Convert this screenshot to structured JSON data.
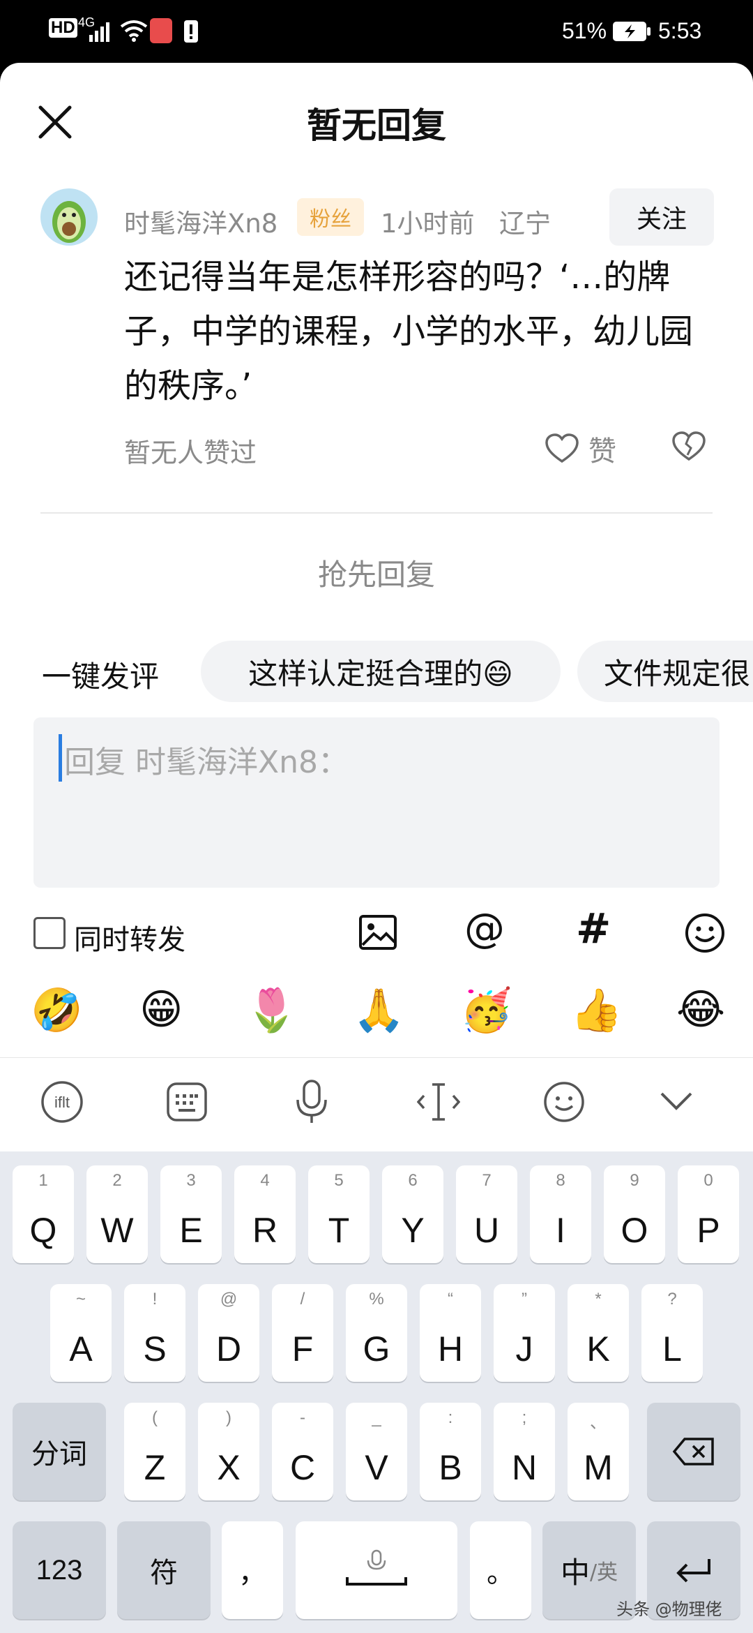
{
  "status_bar": {
    "hd": "HD",
    "network": "4G",
    "battery_percent": "51%",
    "time": "5:53"
  },
  "sheet": {
    "title": "暂无回复"
  },
  "comment": {
    "username": "时髦海洋Xn8",
    "badge": "粉丝",
    "time_ago": "1小时前",
    "location": "辽宁",
    "follow_label": "关注",
    "text": "还记得当年是怎样形容的吗？‘…的牌子，中学的课程，小学的水平，幼儿园的秩序。’",
    "likes_text": "暂无人赞过",
    "like_label": "赞"
  },
  "reply_first": "抢先回复",
  "quick_reply": {
    "label": "一键发评",
    "chips": [
      "这样认定挺合理的😄",
      "文件规定很"
    ]
  },
  "reply_input": {
    "placeholder": "回复 时髦海洋Xn8："
  },
  "repost": {
    "label": "同时转发",
    "checked": false
  },
  "tools": {
    "image_icon": "image-icon",
    "at_symbol": "@",
    "hash_symbol": "#",
    "emoji_icon": "smiley-icon"
  },
  "emoji_row": [
    "🤣",
    "😁",
    "🌷",
    "🙏",
    "🥳",
    "👍",
    "😂"
  ],
  "ime_toolbar": {
    "icons": [
      "ime-logo-icon",
      "keyboard-icon",
      "microphone-icon",
      "cursor-icon",
      "smiley-icon",
      "chevron-down-icon"
    ]
  },
  "keyboard": {
    "row1": [
      {
        "main": "Q",
        "sub": "1"
      },
      {
        "main": "W",
        "sub": "2"
      },
      {
        "main": "E",
        "sub": "3"
      },
      {
        "main": "R",
        "sub": "4"
      },
      {
        "main": "T",
        "sub": "5"
      },
      {
        "main": "Y",
        "sub": "6"
      },
      {
        "main": "U",
        "sub": "7"
      },
      {
        "main": "I",
        "sub": "8"
      },
      {
        "main": "O",
        "sub": "9"
      },
      {
        "main": "P",
        "sub": "0"
      }
    ],
    "row2": [
      {
        "main": "A",
        "sub": "~"
      },
      {
        "main": "S",
        "sub": "!"
      },
      {
        "main": "D",
        "sub": "@"
      },
      {
        "main": "F",
        "sub": "/"
      },
      {
        "main": "G",
        "sub": "%"
      },
      {
        "main": "H",
        "sub": "“"
      },
      {
        "main": "J",
        "sub": "”"
      },
      {
        "main": "K",
        "sub": "*"
      },
      {
        "main": "L",
        "sub": "?"
      }
    ],
    "row3": [
      {
        "main": "Z",
        "sub": "("
      },
      {
        "main": "X",
        "sub": ")"
      },
      {
        "main": "C",
        "sub": "-"
      },
      {
        "main": "V",
        "sub": "_"
      },
      {
        "main": "B",
        "sub": ":"
      },
      {
        "main": "N",
        "sub": ";"
      },
      {
        "main": "M",
        "sub": "、"
      }
    ],
    "fenci": "分词",
    "num": "123",
    "symbol": "符",
    "comma": "，",
    "period": "。",
    "lang_main": "中",
    "lang_sub": "/英"
  },
  "watermark": "头条 @物理佬"
}
